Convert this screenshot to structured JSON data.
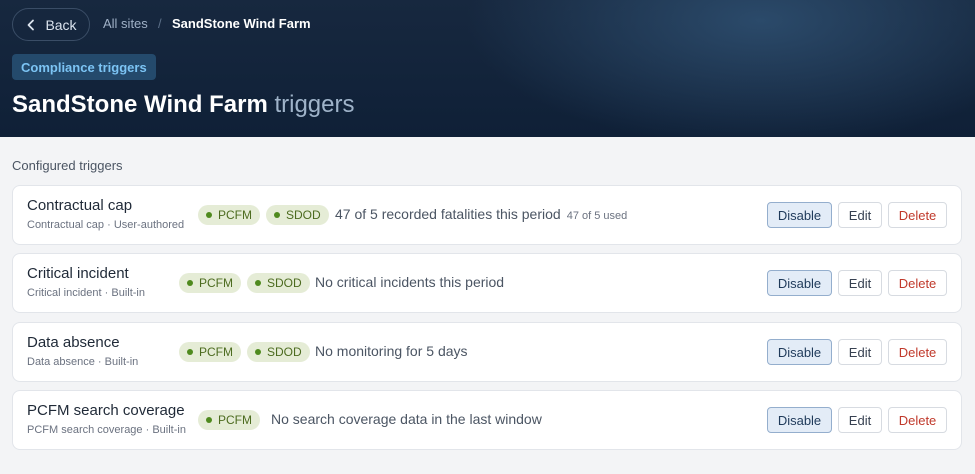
{
  "header": {
    "back_label": "Back",
    "breadcrumb": {
      "parent": "All sites",
      "separator": "/",
      "current": "SandStone Wind Farm"
    },
    "tag": "Compliance triggers",
    "title_main": "SandStone Wind Farm",
    "title_suffix": "triggers"
  },
  "section_label": "Configured triggers",
  "triggers": [
    {
      "name": "Contractual cap",
      "sub": "Contractual cap · User-authored",
      "badges": [
        "PCFM",
        "SDOD"
      ],
      "status": "47 of 5 recorded fatalities this period",
      "status_extra": "47 of 5 used",
      "disable_label": "Disable",
      "edit_label": "Edit",
      "delete_label": "Delete"
    },
    {
      "name": "Critical incident",
      "sub": "Critical incident · Built-in",
      "badges": [
        "PCFM",
        "SDOD"
      ],
      "status": "No critical incidents this period",
      "disable_label": "Disable",
      "edit_label": "Edit",
      "delete_label": "Delete"
    },
    {
      "name": "Data absence",
      "sub": "Data absence · Built-in",
      "badges": [
        "PCFM",
        "SDOD"
      ],
      "status": "No monitoring for 5 days",
      "disable_label": "Disable",
      "edit_label": "Edit",
      "delete_label": "Delete"
    },
    {
      "name": "PCFM search coverage",
      "sub": "PCFM search coverage · Built-in",
      "badges": [
        "PCFM"
      ],
      "status": "No search coverage data in the last window",
      "disable_label": "Disable",
      "edit_label": "Edit",
      "delete_label": "Delete"
    }
  ],
  "icons": {
    "back": "chevron-left-icon",
    "badge_dot": "status-dot-icon"
  },
  "colors": {
    "header_bg": "#0f2037",
    "tag_text": "#7cc4f4",
    "badge_bg": "#e5ecd6",
    "delete_text": "#c0392b"
  }
}
